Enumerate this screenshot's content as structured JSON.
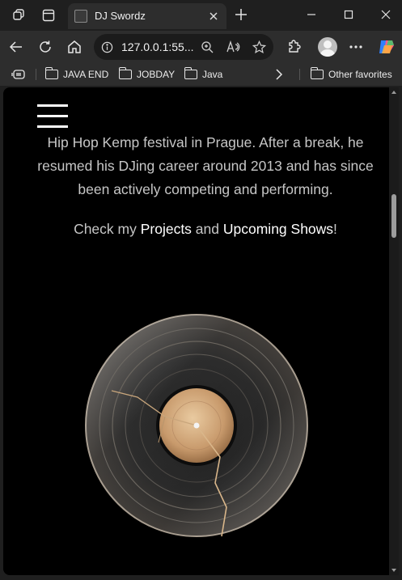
{
  "tab": {
    "title": "DJ Swordz"
  },
  "address": {
    "url": "127.0.0.1:55..."
  },
  "favorites": [
    {
      "label": "JAVA END"
    },
    {
      "label": "JOBDAY"
    },
    {
      "label": "Java"
    }
  ],
  "favorites_other": "Other favorites",
  "page": {
    "bio_lines": [
      "Hip Hop Kemp festival in Prague. After a break, he",
      "resumed his DJing career around 2013 and has since",
      "been actively competing and performing."
    ],
    "cta": {
      "prefix": "Check my ",
      "projects_link": "Projects",
      "middle": " and ",
      "shows_link": "Upcoming Shows",
      "suffix": "!"
    }
  },
  "colors": {
    "page_bg": "#000000",
    "chrome_bg": "#2d2d2d",
    "text": "#c6c6c6",
    "link": "#ffffff"
  },
  "icons": [
    "workspaces-icon",
    "tab-actions-icon",
    "back-icon",
    "refresh-icon",
    "home-icon",
    "info-icon",
    "zoom-icon",
    "read-aloud-icon",
    "favorite-star-icon",
    "extensions-icon",
    "profile-avatar",
    "more-icon",
    "copilot-icon",
    "collections-icon",
    "folder-icon",
    "chevron-right-icon",
    "hamburger-menu-icon",
    "vinyl-record-image"
  ]
}
